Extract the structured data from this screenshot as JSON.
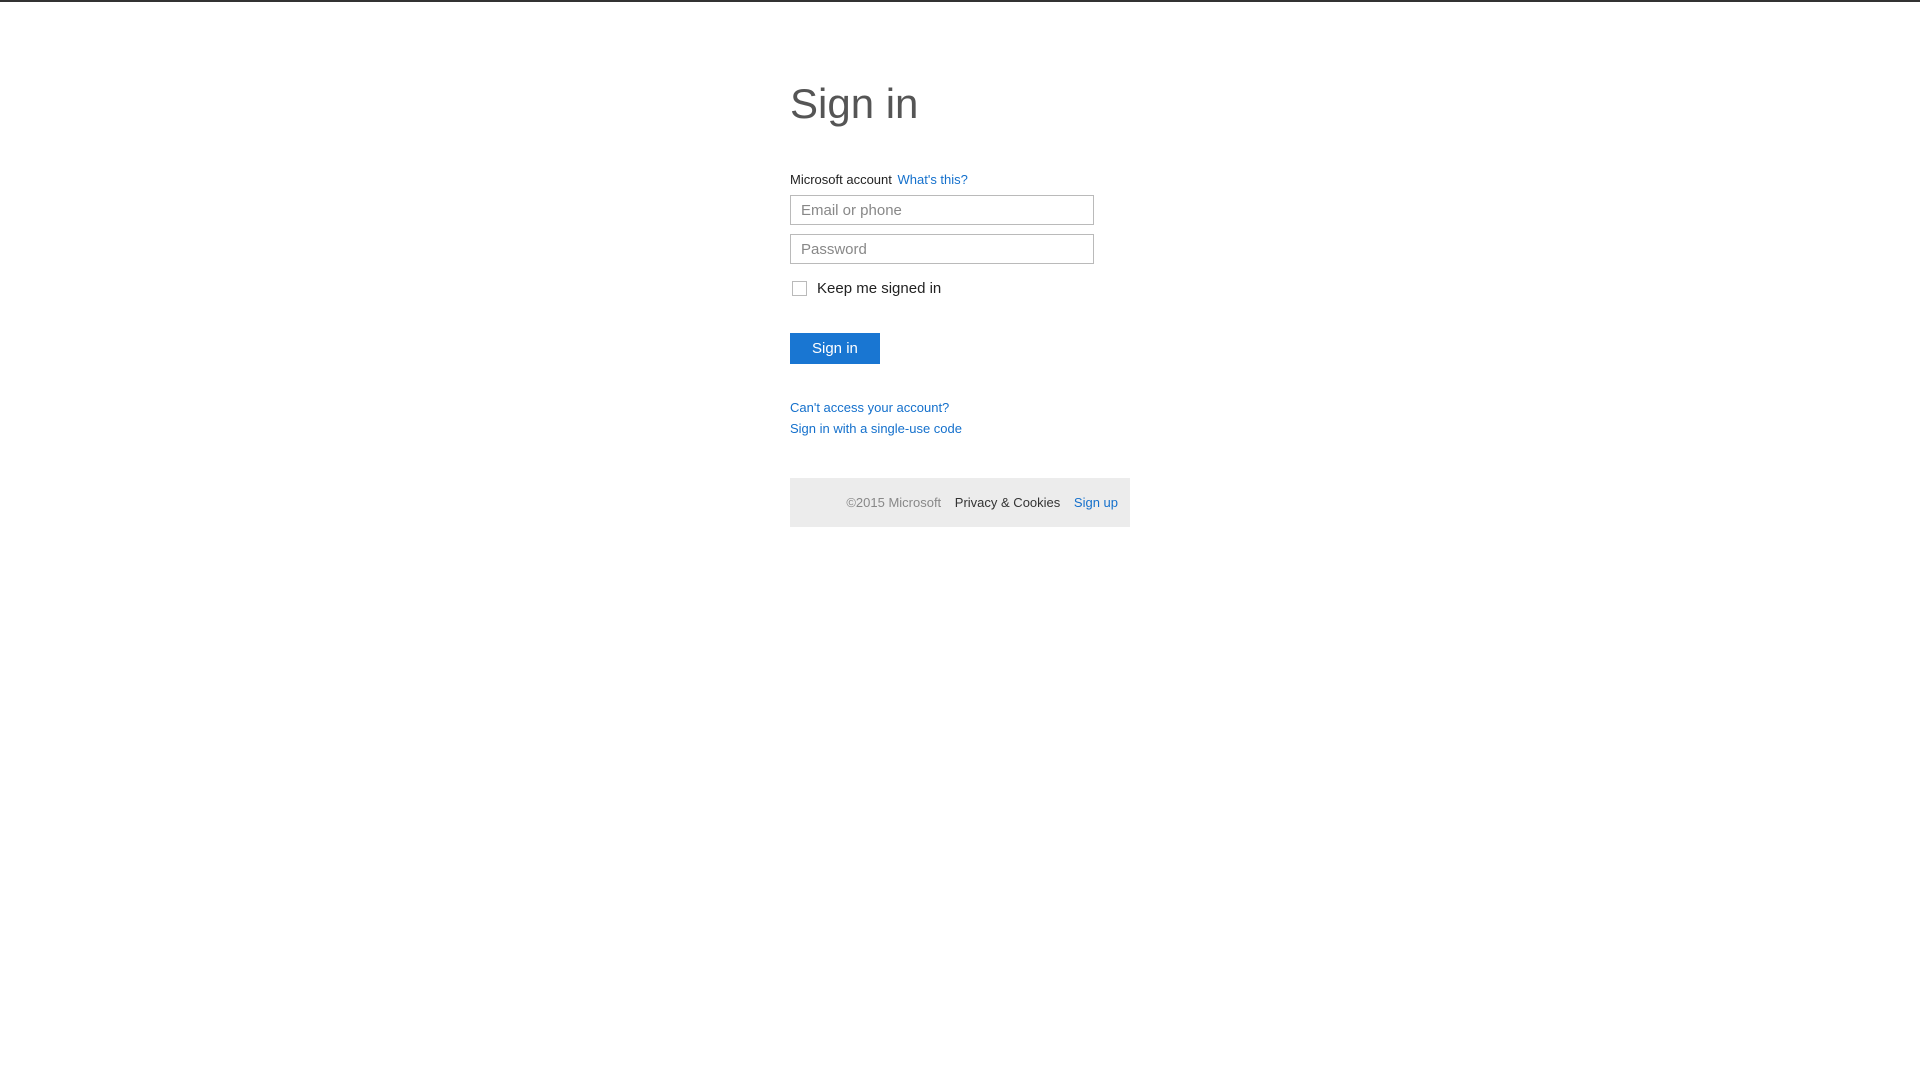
{
  "title": "Sign in",
  "account": {
    "label": "Microsoft account",
    "whats_this": "What's this?"
  },
  "inputs": {
    "email_placeholder": "Email or phone",
    "password_placeholder": "Password"
  },
  "checkbox": {
    "label": "Keep me signed in"
  },
  "buttons": {
    "signin": "Sign in"
  },
  "help_links": {
    "cant_access": "Can't access your account?",
    "single_use": "Sign in with a single-use code"
  },
  "footer": {
    "copyright": "©2015 Microsoft",
    "privacy": "Privacy & Cookies",
    "signup": "Sign up"
  }
}
